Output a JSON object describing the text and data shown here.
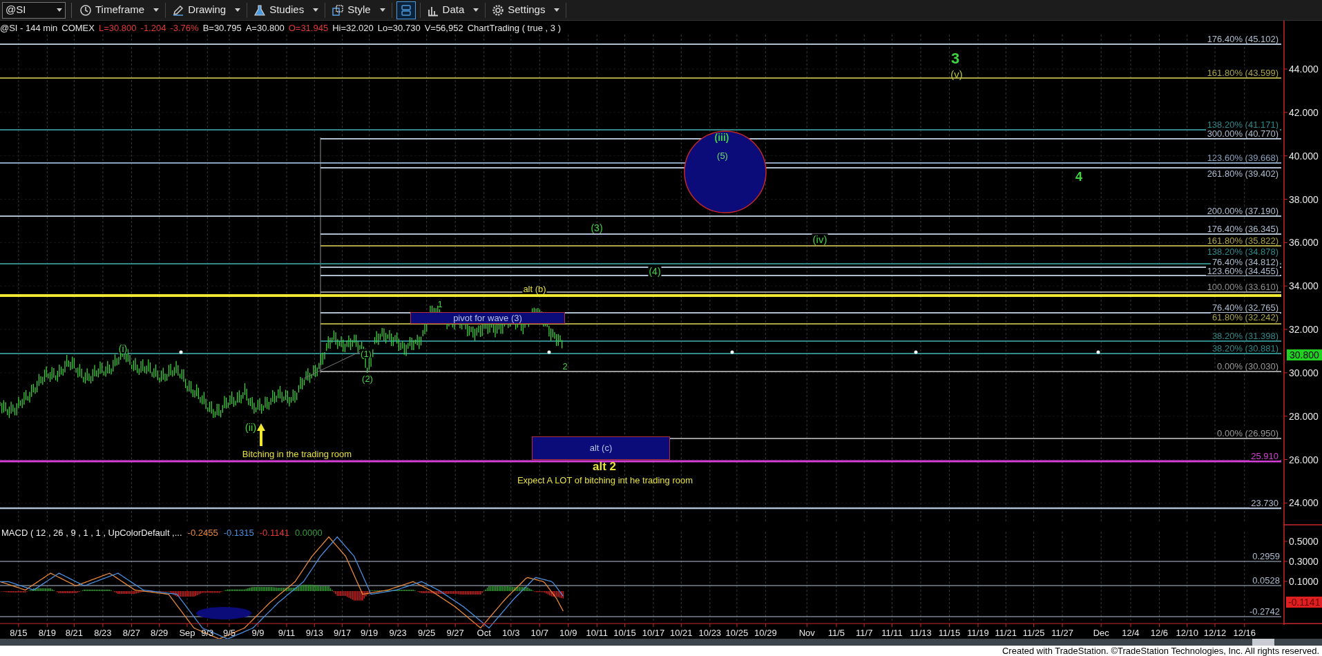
{
  "toolbar": {
    "symbol": "@SI",
    "items": [
      {
        "kind": "menu",
        "label": "Timeframe"
      },
      {
        "kind": "menu",
        "label": "Drawing"
      },
      {
        "kind": "menu",
        "label": "Studies"
      },
      {
        "kind": "menu",
        "label": "Style"
      },
      {
        "kind": "layout",
        "selected": true
      },
      {
        "kind": "menu",
        "label": "Data"
      },
      {
        "kind": "menu",
        "label": "Settings"
      }
    ]
  },
  "header": [
    {
      "text": "@SI - 144 min",
      "color": "#e5e5e5"
    },
    {
      "text": "COMEX",
      "color": "#e5e5e5"
    },
    {
      "text": "L=30.800",
      "color": "#e53935"
    },
    {
      "text": "-1.204",
      "color": "#e53935"
    },
    {
      "text": "-3.76%",
      "color": "#e53935"
    },
    {
      "text": "B=30.795",
      "color": "#e5e5e5"
    },
    {
      "text": "A=30.800",
      "color": "#e5e5e5"
    },
    {
      "text": "O=31.945",
      "color": "#e53935"
    },
    {
      "text": "Hi=32.020",
      "color": "#e5e5e5"
    },
    {
      "text": "Lo=30.730",
      "color": "#e5e5e5"
    },
    {
      "text": "V=56,952",
      "color": "#e5e5e5"
    },
    {
      "text": "ChartTrading ( true , 3 )",
      "color": "#e5e5e5"
    }
  ],
  "fib_levels": [
    {
      "label": "176.40% (45.102)",
      "color": "#aebdd0"
    },
    {
      "label": "161.80% (43.599)",
      "color": "#aaa447"
    },
    {
      "label": "138.20% (41.171)",
      "color": "#2e8a8a"
    },
    {
      "label": "300.00% (40.770)",
      "color": "#aebdd0"
    },
    {
      "label": "123.60% (39.668)",
      "color": "#8aa0bc"
    },
    {
      "label": "261.80% (39.402)",
      "color": "#aebdd0"
    },
    {
      "label": "200.00% (37.190)",
      "color": "#aebdd0"
    },
    {
      "label": "176.40% (36.345)",
      "color": "#aebdd0"
    },
    {
      "label": "161.80% (35.822)",
      "color": "#aaa447"
    },
    {
      "label": "138.20% (34.878)",
      "color": "#2e8a8a"
    },
    {
      "label": "76.40% (34.812)",
      "color": "#aebdd0"
    },
    {
      "label": "123.60% (34.455)",
      "color": "#aebdd0"
    },
    {
      "label": "100.00% (33.610)",
      "color": "#8f8f8f"
    },
    {
      "label": "76.40% (32.765)",
      "color": "#aebdd0"
    },
    {
      "label": "61.80% (32.242)",
      "color": "#aaa447"
    },
    {
      "label": "38.20% (31.398)",
      "color": "#2e8a8a"
    },
    {
      "label": "38.20% (30.881)",
      "color": "#2e8a8a"
    },
    {
      "label": "0.00% (30.030)",
      "color": "#9a9a9a"
    },
    {
      "label": "0.00% (26.950)",
      "color": "#9a9a9a"
    },
    {
      "label": "25.910",
      "color": "#d63fd6"
    },
    {
      "label": "23.730",
      "color": "#aebdd0"
    }
  ],
  "price_axis": [
    "44.000",
    "42.000",
    "40.000",
    "38.000",
    "36.000",
    "34.000",
    "32.000",
    "30.000",
    "28.000",
    "26.000",
    "24.000"
  ],
  "last_price": "30.800",
  "annotations": [
    {
      "text": "3",
      "color": "#3fd43f"
    },
    {
      "text": "(v)",
      "color": "#b8c83a"
    },
    {
      "text": "(iii)",
      "color": "#3fd43f"
    },
    {
      "text": "(5)",
      "color": "#6fe06f"
    },
    {
      "text": "4",
      "color": "#3fd43f"
    },
    {
      "text": "(3)",
      "color": "#3fd43f"
    },
    {
      "text": "(iv)",
      "color": "#3fd43f"
    },
    {
      "text": "(4)",
      "color": "#3fd43f"
    },
    {
      "text": "alt (b)",
      "color": "#e6e040"
    },
    {
      "text": "1",
      "color": "#3fd43f"
    },
    {
      "text": "(i)",
      "color": "#3fd43f"
    },
    {
      "text": "(1)",
      "color": "#3fd43f"
    },
    {
      "text": "(2)",
      "color": "#3fd43f"
    },
    {
      "text": "2",
      "color": "#3fd43f"
    },
    {
      "text": "(ii)",
      "color": "#3fd43f"
    },
    {
      "text": "Bitching in the trading room",
      "color": "#e6e040"
    },
    {
      "text": "alt 2",
      "color": "#e6e040"
    },
    {
      "text": "Expect A LOT of bitching int he trading room",
      "color": "#e6e040"
    }
  ],
  "boxes": [
    {
      "text": "pivot for wave (3)"
    },
    {
      "text": "alt (c)"
    }
  ],
  "macd": {
    "title": "MACD ( 12 , 26 , 9 , 1 , 1 , UpColorDefault ,...",
    "values": [
      {
        "text": "-0.2455",
        "color": "#e8883a"
      },
      {
        "text": "-0.1315",
        "color": "#4a8fe0"
      },
      {
        "text": "-0.1141",
        "color": "#e53935"
      },
      {
        "text": "0.0000",
        "color": "#3a9a3a"
      }
    ],
    "axis": [
      "0.5000",
      "0.3000",
      "0.1000"
    ],
    "levels": [
      "0.2959",
      "0.0528",
      "-0.2742"
    ],
    "last": "-0.1141"
  },
  "dates": [
    "8/15",
    "8/19",
    "8/21",
    "8/23",
    "8/27",
    "8/29",
    "Sep",
    "9/3",
    "9/5",
    "9/9",
    "9/11",
    "9/13",
    "9/17",
    "9/19",
    "9/23",
    "9/25",
    "9/27",
    "Oct",
    "10/3",
    "10/7",
    "10/9",
    "10/11",
    "10/15",
    "10/17",
    "10/21",
    "10/23",
    "10/25",
    "10/29",
    "Nov",
    "11/5",
    "11/7",
    "11/11",
    "11/13",
    "11/15",
    "11/19",
    "11/21",
    "11/25",
    "11/27",
    "Dec",
    "12/4",
    "12/6",
    "12/10",
    "12/12",
    "12/16"
  ],
  "footer": "Created with TradeStation. ©TradeStation Technologies, Inc. All rights reserved."
}
